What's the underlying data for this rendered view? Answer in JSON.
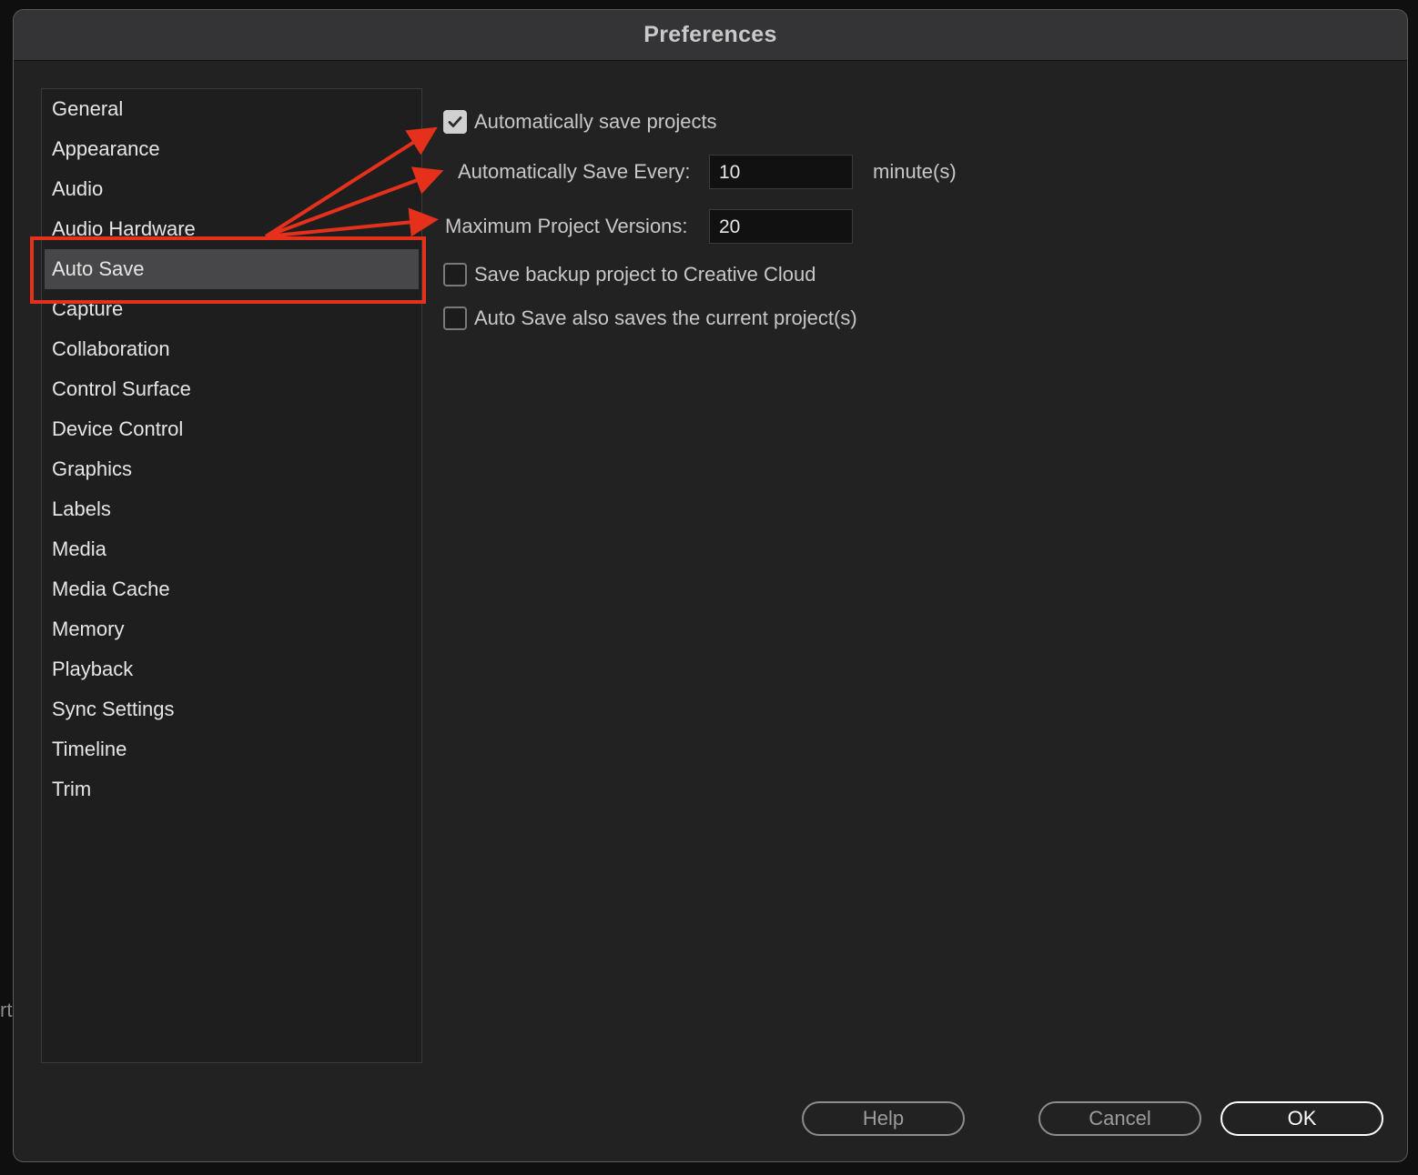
{
  "window": {
    "title": "Preferences",
    "background_edge_text": "rt"
  },
  "sidebar": {
    "items": [
      {
        "label": "General",
        "selected": false
      },
      {
        "label": "Appearance",
        "selected": false
      },
      {
        "label": "Audio",
        "selected": false
      },
      {
        "label": "Audio Hardware",
        "selected": false
      },
      {
        "label": "Auto Save",
        "selected": true
      },
      {
        "label": "Capture",
        "selected": false
      },
      {
        "label": "Collaboration",
        "selected": false
      },
      {
        "label": "Control Surface",
        "selected": false
      },
      {
        "label": "Device Control",
        "selected": false
      },
      {
        "label": "Graphics",
        "selected": false
      },
      {
        "label": "Labels",
        "selected": false
      },
      {
        "label": "Media",
        "selected": false
      },
      {
        "label": "Media Cache",
        "selected": false
      },
      {
        "label": "Memory",
        "selected": false
      },
      {
        "label": "Playback",
        "selected": false
      },
      {
        "label": "Sync Settings",
        "selected": false
      },
      {
        "label": "Timeline",
        "selected": false
      },
      {
        "label": "Trim",
        "selected": false
      }
    ]
  },
  "auto_save": {
    "auto_save_projects": {
      "label": "Automatically save projects",
      "checked": true
    },
    "save_every": {
      "label": "Automatically Save Every:",
      "value": "10",
      "unit": "minute(s)"
    },
    "max_versions": {
      "label": "Maximum Project Versions:",
      "value": "20"
    },
    "backup_creative_cloud": {
      "label": "Save backup project to Creative Cloud",
      "checked": false
    },
    "save_current_project": {
      "label": "Auto Save also saves the current project(s)",
      "checked": false
    }
  },
  "footer": {
    "help_label": "Help",
    "cancel_label": "Cancel",
    "ok_label": "OK"
  },
  "colors": {
    "dialog_bg": "#222222",
    "titlebar_bg": "#343437",
    "selected_item_bg": "#474749",
    "annotation_red": "#e5311b"
  }
}
